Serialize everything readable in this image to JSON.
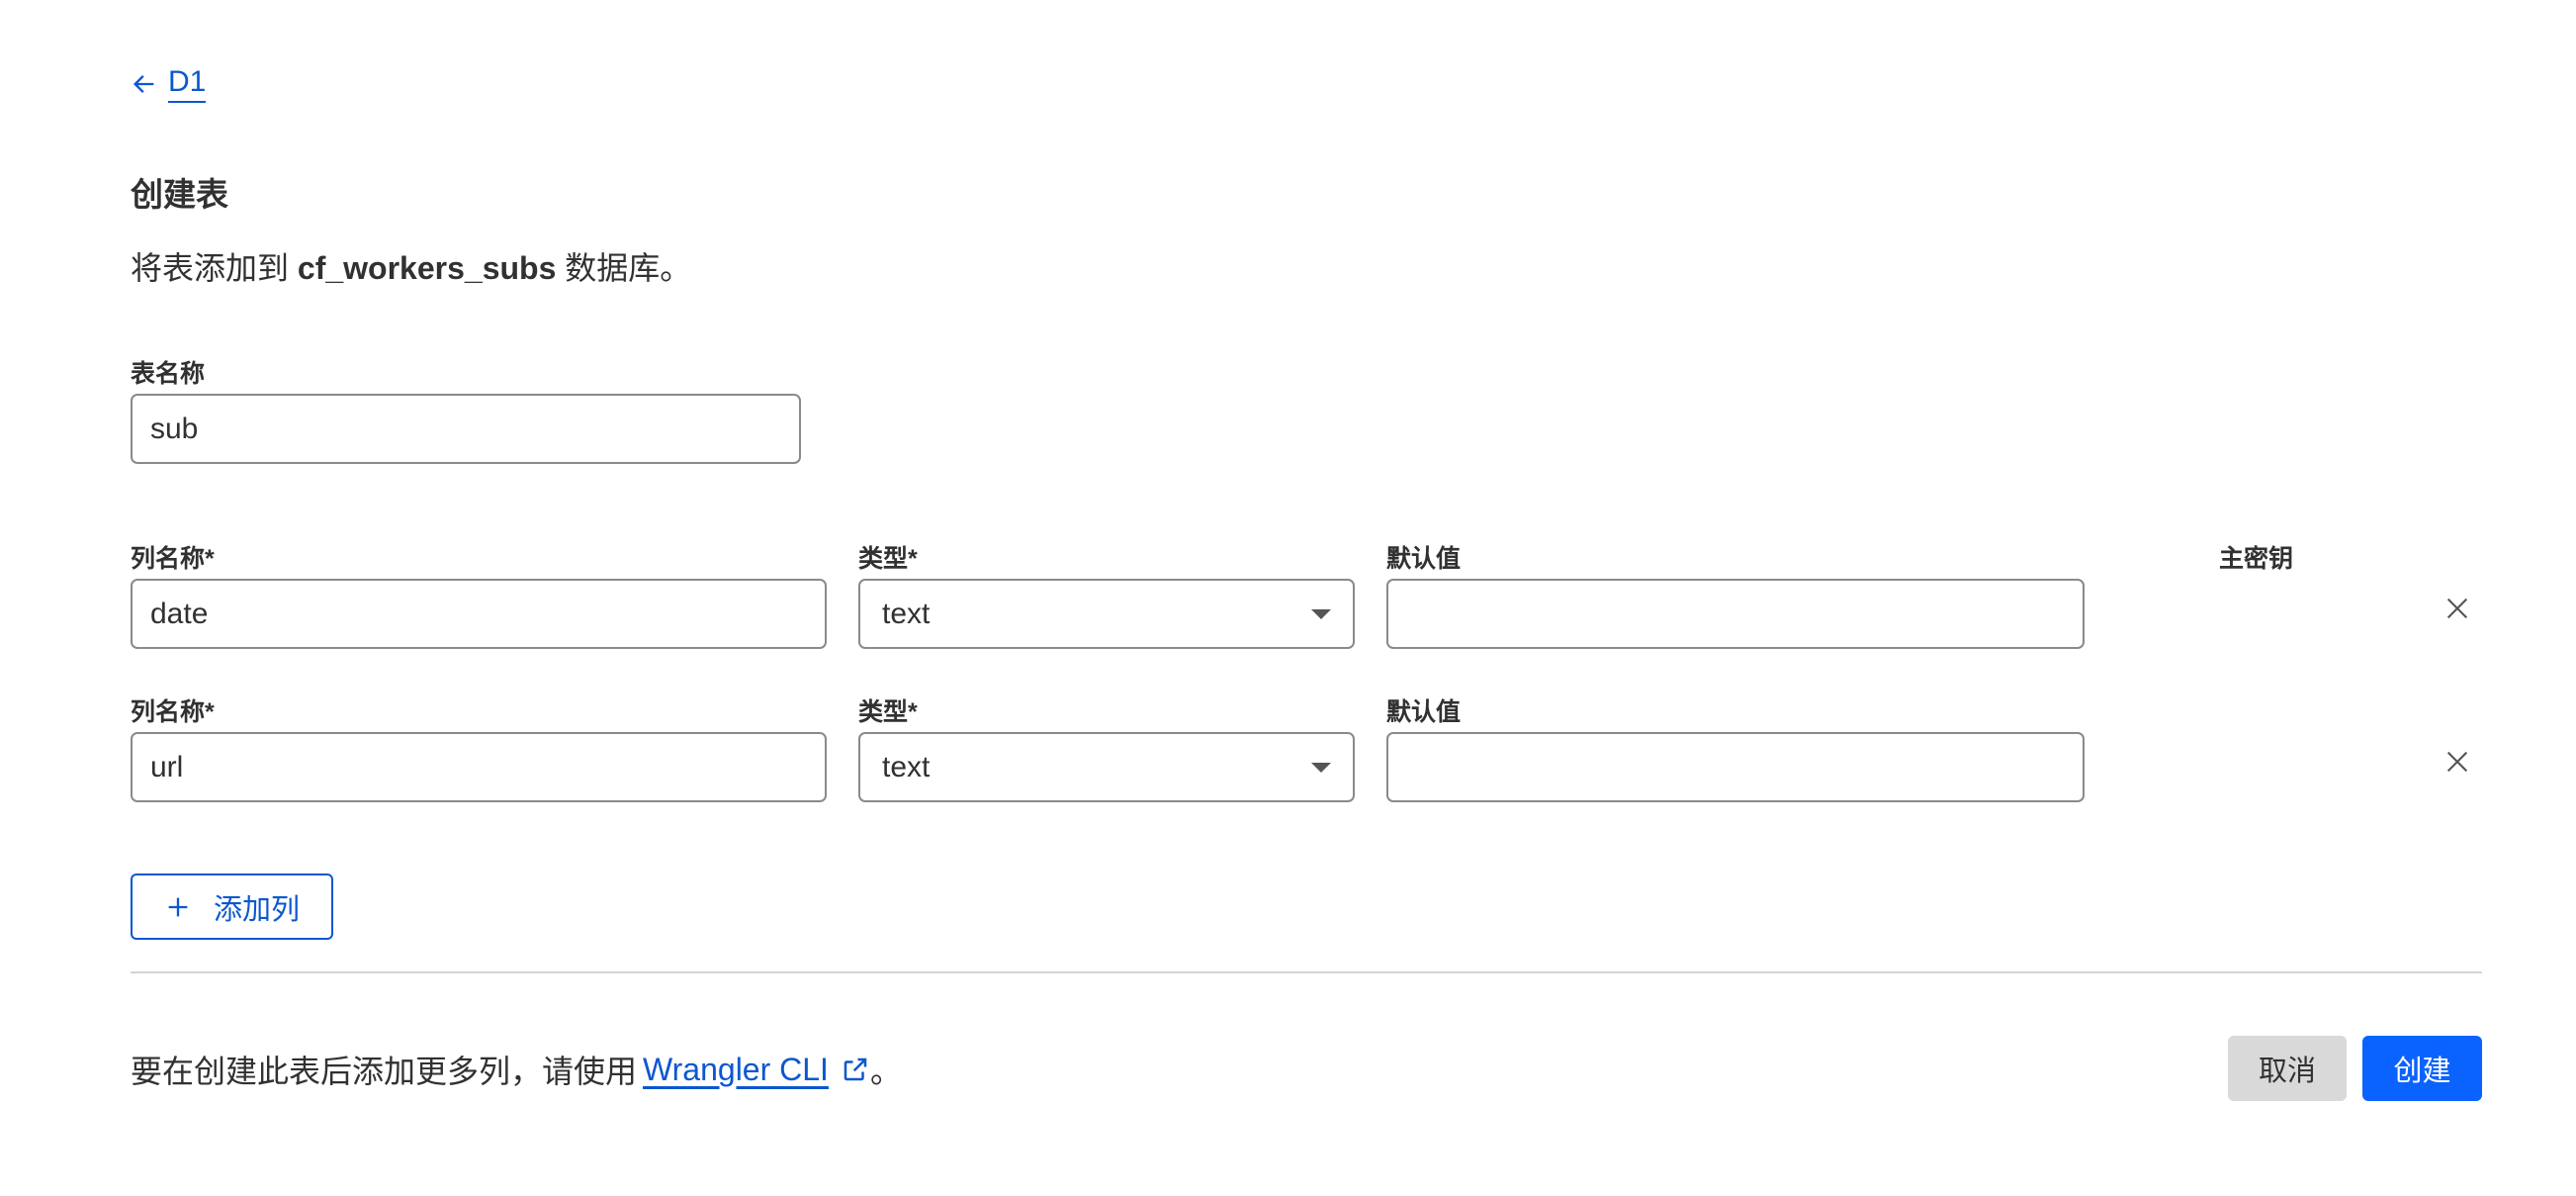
{
  "nav": {
    "back_label": "D1"
  },
  "page": {
    "title": "创建表",
    "subtitle_prefix": "将表添加到 ",
    "database_name": "cf_workers_subs",
    "subtitle_suffix": " 数据库。"
  },
  "table_name": {
    "label": "表名称",
    "value": "sub"
  },
  "columns_header": {
    "primary_key_label": "主密钥"
  },
  "columns": [
    {
      "name_label": "列名称*",
      "name_value": "date",
      "type_label": "类型*",
      "type_value": "text",
      "default_label": "默认值",
      "default_value": ""
    },
    {
      "name_label": "列名称*",
      "name_value": "url",
      "type_label": "类型*",
      "type_value": "text",
      "default_label": "默认值",
      "default_value": ""
    }
  ],
  "actions": {
    "add_column": "添加列",
    "cancel": "取消",
    "create": "创建"
  },
  "footer": {
    "note_prefix": "要在创建此表后添加更多列，请使用",
    "link_text": "Wrangler CLI",
    "note_suffix": "。"
  },
  "colors": {
    "accent": "#0b57d0",
    "primary_button": "#0b63ff",
    "secondary_button": "#d9d9d9"
  }
}
